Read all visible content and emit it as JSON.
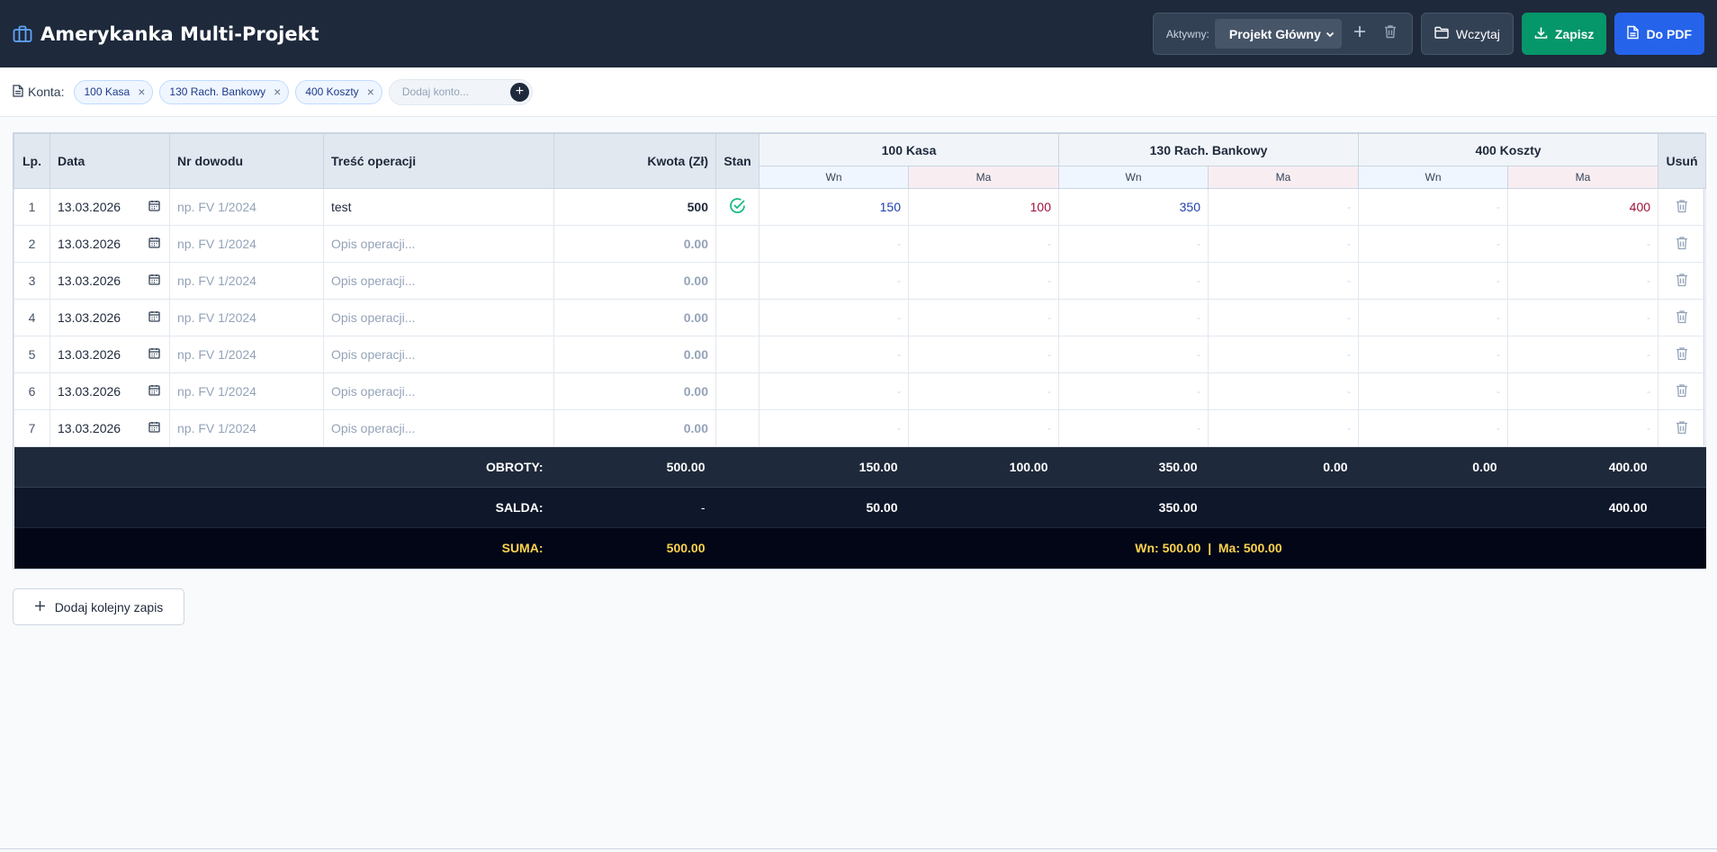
{
  "app": {
    "title": "Amerykanka Multi-Projekt"
  },
  "header": {
    "active_label": "Aktywny:",
    "project": "Projekt Główny",
    "load_label": "Wczytaj",
    "save_label": "Zapisz",
    "pdf_label": "Do PDF"
  },
  "accounts_bar": {
    "label": "Konta:",
    "chips": [
      "100 Kasa",
      "130 Rach. Bankowy",
      "400 Koszty"
    ],
    "add_placeholder": "Dodaj konto..."
  },
  "table": {
    "headers": {
      "lp": "Lp.",
      "date": "Data",
      "doc": "Nr dowodu",
      "desc": "Treść operacji",
      "amount": "Kwota (Zł)",
      "state": "Stan",
      "delete": "Usuń",
      "wn": "Wn",
      "ma": "Ma"
    },
    "accounts": [
      "100 Kasa",
      "130 Rach. Bankowy",
      "400 Koszty"
    ],
    "doc_placeholder": "np. FV 1/2024",
    "desc_placeholder": "Opis operacji...",
    "dash": "-",
    "rows": [
      {
        "lp": "1",
        "date": "13.03.2026",
        "doc": "",
        "desc": "test",
        "amount": "500",
        "ok": true,
        "cells": [
          "150",
          "100",
          "350",
          "-",
          "-",
          "400"
        ]
      },
      {
        "lp": "2",
        "date": "13.03.2026",
        "doc": "",
        "desc": "",
        "amount": "0.00",
        "ok": false,
        "cells": [
          "-",
          "-",
          "-",
          "-",
          "-",
          "-"
        ]
      },
      {
        "lp": "3",
        "date": "13.03.2026",
        "doc": "",
        "desc": "",
        "amount": "0.00",
        "ok": false,
        "cells": [
          "-",
          "-",
          "-",
          "-",
          "-",
          "-"
        ]
      },
      {
        "lp": "4",
        "date": "13.03.2026",
        "doc": "",
        "desc": "",
        "amount": "0.00",
        "ok": false,
        "cells": [
          "-",
          "-",
          "-",
          "-",
          "-",
          "-"
        ]
      },
      {
        "lp": "5",
        "date": "13.03.2026",
        "doc": "",
        "desc": "",
        "amount": "0.00",
        "ok": false,
        "cells": [
          "-",
          "-",
          "-",
          "-",
          "-",
          "-"
        ]
      },
      {
        "lp": "6",
        "date": "13.03.2026",
        "doc": "",
        "desc": "",
        "amount": "0.00",
        "ok": false,
        "cells": [
          "-",
          "-",
          "-",
          "-",
          "-",
          "-"
        ]
      },
      {
        "lp": "7",
        "date": "13.03.2026",
        "doc": "",
        "desc": "",
        "amount": "0.00",
        "ok": false,
        "cells": [
          "-",
          "-",
          "-",
          "-",
          "-",
          "-"
        ]
      }
    ],
    "footer": {
      "obroty_label": "OBROTY:",
      "obroty_amount": "500.00",
      "obroty_values": [
        "150.00",
        "100.00",
        "350.00",
        "0.00",
        "0.00",
        "400.00"
      ],
      "salda_label": "SALDA:",
      "salda_amount": "-",
      "salda_values": [
        "50.00",
        "350.00",
        "400.00"
      ],
      "suma_label": "SUMA:",
      "suma_amount": "500.00",
      "suma_text": "Wn: 500.00  |  Ma: 500.00"
    }
  },
  "add_row_label": "Dodaj kolejny zapis",
  "colors": {
    "header_bg": "#1e293b",
    "save": "#059669",
    "pdf": "#2563eb",
    "wn": "#1e40af",
    "ma": "#9f1239",
    "ok": "#10b981",
    "gold": "#fcd34d"
  }
}
